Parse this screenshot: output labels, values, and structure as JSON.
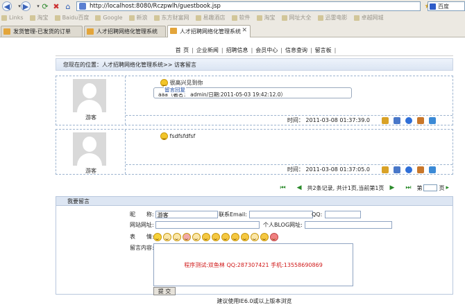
{
  "browser": {
    "url": "http://localhost:8080/Rczpwlh/guestbook.jsp",
    "search_engine": "百度",
    "bookmarks": [
      "Links",
      "淘宝",
      "Baidu百度",
      "Google",
      "新浪",
      "东方财富网",
      "易趣酒店",
      "软件",
      "淘宝",
      "网址大全",
      "迅雷电影",
      "卓越网城"
    ],
    "tabs": [
      {
        "label": "发货管理-已发货的订单",
        "active": false
      },
      {
        "label": "人才招聘网络化管理系统",
        "active": false
      },
      {
        "label": "人才招聘网络化管理系统",
        "active": true
      }
    ]
  },
  "nav": {
    "items": [
      "首 页",
      "企业新闻",
      "招聘信息",
      "会员中心",
      "信息查询",
      "留言板"
    ]
  },
  "breadcrumb": "您现在的位置：人才招聘网络化管理系统>> 访客留言",
  "messages": [
    {
      "author": "游客",
      "text": "很高兴见到你",
      "reply_title": "留言回复",
      "reply_text": "aaa（署名： admin/日期:2011-05-03 19:42:12.0）",
      "time": "时间： 2011-03-08 01:37:39.0"
    },
    {
      "author": "游客",
      "text": "fsdfsfdfsf",
      "time": "时间： 2011-03-08 01:37:05.0"
    }
  ],
  "pager": {
    "summary": "共2条记录, 共计1页,当前第1页",
    "goto_prefix": "第",
    "goto_suffix": "页"
  },
  "form": {
    "heading": "我要留言",
    "nickname_label": "昵　　称:",
    "nickname_value": "游客",
    "email_label": "联系Email:",
    "qq_label": "QQ:",
    "website_label": "网站网址:",
    "blog_label": "个人BLOG网址:",
    "expression_label": "表　　情:",
    "content_label": "留言内容:",
    "content_hint": "程序测试:双鱼林 QQ:287307421 手机:13558690869",
    "submit_label": "提 交"
  },
  "footer": "建议使用IE6.0或以上版本浏览",
  "colors": {
    "accent": "#1f4ea3",
    "hint_red": "#d01818",
    "border_blue": "#9cb3cf"
  }
}
